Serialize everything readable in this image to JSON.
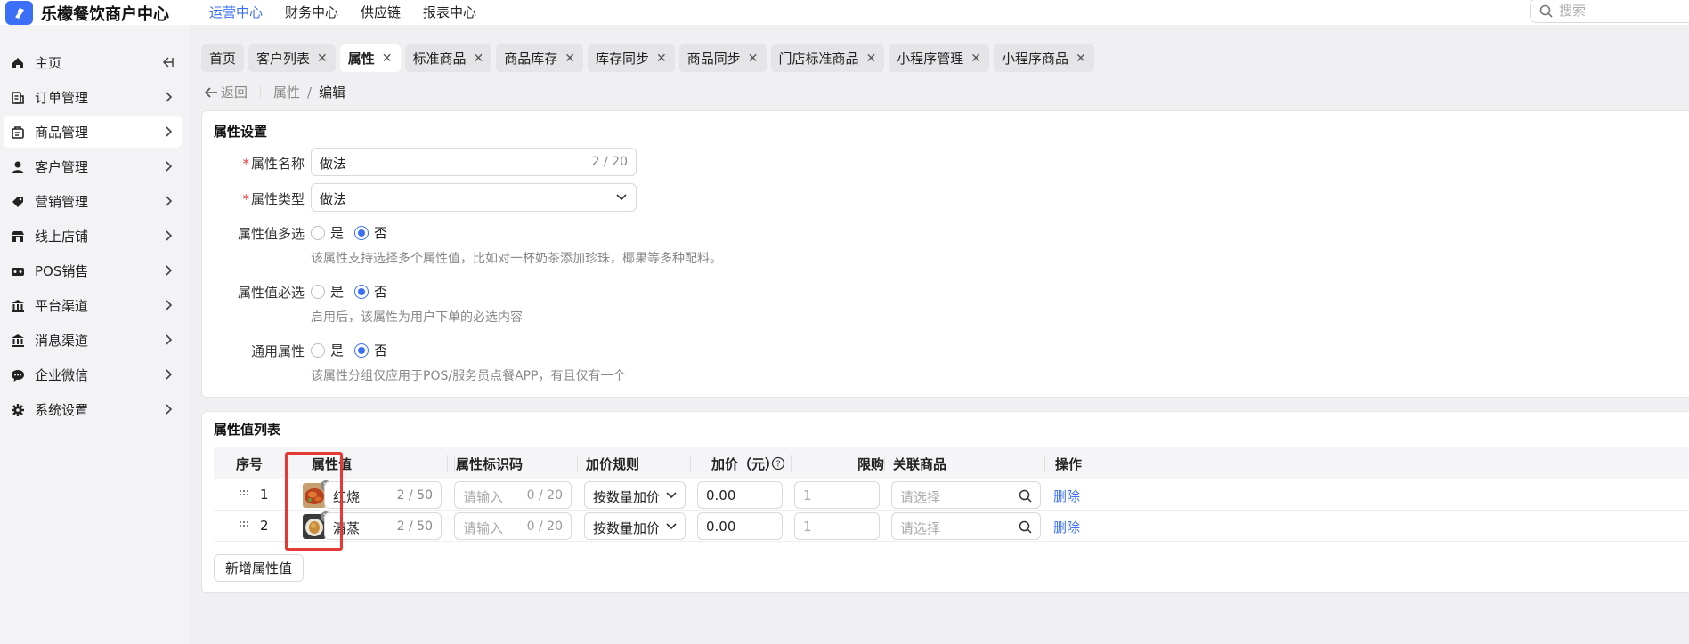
{
  "app": {
    "title": "乐檬餐饮商户中心"
  },
  "top_nav": [
    {
      "label": "运营中心",
      "active": true
    },
    {
      "label": "财务中心",
      "active": false
    },
    {
      "label": "供应链",
      "active": false
    },
    {
      "label": "报表中心",
      "active": false
    }
  ],
  "search": {
    "placeholder": "搜索"
  },
  "sidebar": {
    "items": [
      {
        "label": "主页",
        "icon": "home-icon"
      },
      {
        "label": "订单管理",
        "icon": "order-icon"
      },
      {
        "label": "商品管理",
        "icon": "product-icon",
        "active": true
      },
      {
        "label": "客户管理",
        "icon": "user-icon"
      },
      {
        "label": "营销管理",
        "icon": "tag-icon"
      },
      {
        "label": "线上店铺",
        "icon": "store-icon"
      },
      {
        "label": "POS销售",
        "icon": "pos-icon"
      },
      {
        "label": "平台渠道",
        "icon": "bank-icon"
      },
      {
        "label": "消息渠道",
        "icon": "bank-icon"
      },
      {
        "label": "企业微信",
        "icon": "chat-icon"
      },
      {
        "label": "系统设置",
        "icon": "gear-icon"
      }
    ]
  },
  "tabs": [
    {
      "label": "首页",
      "closable": false
    },
    {
      "label": "客户列表",
      "closable": true
    },
    {
      "label": "属性",
      "closable": true,
      "active": true
    },
    {
      "label": "标准商品",
      "closable": true
    },
    {
      "label": "商品库存",
      "closable": true
    },
    {
      "label": "库存同步",
      "closable": true
    },
    {
      "label": "商品同步",
      "closable": true
    },
    {
      "label": "门店标准商品",
      "closable": true
    },
    {
      "label": "小程序管理",
      "closable": true
    },
    {
      "label": "小程序商品",
      "closable": true
    }
  ],
  "breadcrumb": {
    "back": "返回",
    "parent": "属性",
    "sep": "/",
    "current": "编辑"
  },
  "settings": {
    "title": "属性设置",
    "name_label": "属性名称",
    "name_value": "做法",
    "name_count": "2 / 20",
    "type_label": "属性类型",
    "type_value": "做法",
    "multi_label": "属性值多选",
    "multi_hint": "该属性支持选择多个属性值，比如对一杯奶茶添加珍珠，椰果等多种配料。",
    "required_label": "属性值必选",
    "required_hint": "启用后，该属性为用户下单的必选内容",
    "common_label": "通用属性",
    "common_hint": "该属性分组仅应用于POS/服务员点餐APP，有且仅有一个",
    "yes": "是",
    "no": "否"
  },
  "value_list": {
    "title": "属性值列表",
    "columns": [
      "序号",
      "属性值",
      "属性标识码",
      "加价规则",
      "加价（元）",
      "限购",
      "关联商品",
      "操作"
    ],
    "rows": [
      {
        "no": "1",
        "value": "红烧",
        "value_count": "2 / 50",
        "code_placeholder": "请输入",
        "code_count": "0 / 20",
        "rule": "按数量加价",
        "price": "0.00",
        "limit_placeholder": "1",
        "product_placeholder": "请选择",
        "action": "删除"
      },
      {
        "no": "2",
        "value": "清蒸",
        "value_count": "2 / 50",
        "code_placeholder": "请输入",
        "code_count": "0 / 20",
        "rule": "按数量加价",
        "price": "0.00",
        "limit_placeholder": "1",
        "product_placeholder": "请选择",
        "action": "删除"
      }
    ],
    "add_button": "新增属性值"
  },
  "colors": {
    "accent": "#3b6ff5",
    "highlight": "#e53935",
    "required": "#e53935"
  }
}
